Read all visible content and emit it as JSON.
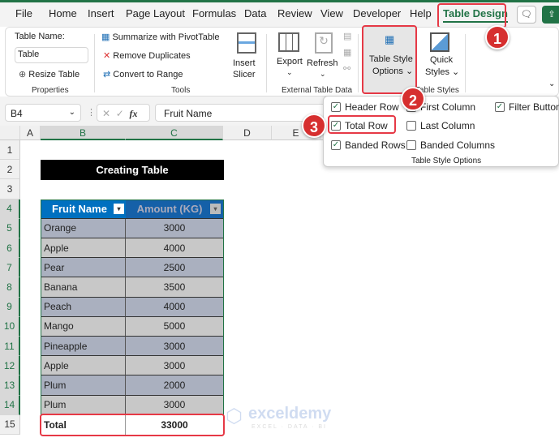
{
  "tabs": [
    "File",
    "Home",
    "Insert",
    "Page Layout",
    "Formulas",
    "Data",
    "Review",
    "View",
    "Developer",
    "Help",
    "Table Design"
  ],
  "ribbon": {
    "table_name_label": "Table Name:",
    "table_name_value": "Table",
    "resize_table": "Resize Table",
    "properties_group": "Properties",
    "summarize": "Summarize with PivotTable",
    "remove_duplicates": "Remove Duplicates",
    "convert_range": "Convert to Range",
    "tools_group": "Tools",
    "insert_slicer_1": "Insert",
    "insert_slicer_2": "Slicer",
    "export": "Export",
    "refresh": "Refresh",
    "external_group": "External Table Data",
    "tso_1": "Table Style",
    "tso_2": "Options",
    "quick_1": "Quick",
    "quick_2": "Styles",
    "table_styles_group": "Table Styles"
  },
  "badges": [
    "1",
    "2",
    "3"
  ],
  "formula_bar": {
    "name_box": "B4",
    "fx": "fx",
    "value": "Fruit Name"
  },
  "columns": [
    "A",
    "B",
    "C",
    "D",
    "E"
  ],
  "rows": [
    "1",
    "2",
    "3",
    "4",
    "5",
    "6",
    "7",
    "8",
    "9",
    "10",
    "11",
    "12",
    "13",
    "14",
    "15"
  ],
  "sheet": {
    "title": "Creating Table",
    "headers": [
      "Fruit Name",
      "Amount (KG)"
    ],
    "data": [
      [
        "Orange",
        "3000"
      ],
      [
        "Apple",
        "4000"
      ],
      [
        "Pear",
        "2500"
      ],
      [
        "Banana",
        "3500"
      ],
      [
        "Peach",
        "4000"
      ],
      [
        "Mango",
        "5000"
      ],
      [
        "Pineapple",
        "3000"
      ],
      [
        "Apple",
        "3000"
      ],
      [
        "Plum",
        "2000"
      ],
      [
        "Plum",
        "3000"
      ]
    ],
    "total_label": "Total",
    "total_value": "33000"
  },
  "style_options": {
    "header_row": "Header Row",
    "total_row": "Total Row",
    "banded_rows": "Banded Rows",
    "first_column": "First Column",
    "last_column": "Last Column",
    "banded_columns": "Banded Columns",
    "filter_button": "Filter Button",
    "group_label": "Table Style Options"
  },
  "watermark": {
    "name": "exceldemy",
    "tag": "EXCEL · DATA · BI"
  }
}
